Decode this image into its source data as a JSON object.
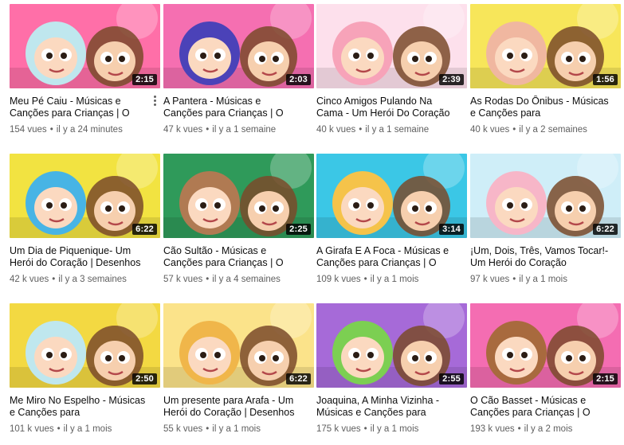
{
  "videos": [
    {
      "title": "Meu Pé Caiu - Músicas e Canções para Crianças | O",
      "views": "154 vues",
      "age": "il y a 24 minutes",
      "duration": "2:15",
      "bg": "#ff6fa8",
      "accent": "#bfe7ee",
      "icon": "kids-dentist-thumbnail-icon",
      "menu": true
    },
    {
      "title": "A Pantera - Músicas e Canções para Crianças | O",
      "views": "47 k vues",
      "age": "il y a 1 semaine",
      "duration": "2:03",
      "bg": "#f56fb1",
      "accent": "#4b42b8",
      "icon": "blue-panther-thumbnail-icon"
    },
    {
      "title": "Cinco Amigos Pulando Na Cama - Um Herói Do Coração",
      "views": "40 k vues",
      "age": "il y a 1 semaine",
      "duration": "2:39",
      "bg": "#fde0ec",
      "accent": "#f7a3b9",
      "icon": "piglet-friends-thumbnail-icon"
    },
    {
      "title": "As Rodas Do Ônibus - Músicas e Canções para",
      "views": "40 k vues",
      "age": "il y a 2 semaines",
      "duration": "1:56",
      "bg": "#f7e65a",
      "accent": "#f0b7a0",
      "icon": "cat-bus-driver-thumbnail-icon"
    },
    {
      "title": "Um Dia de Piquenique- Um Herói do Coração | Desenhos",
      "views": "42 k vues",
      "age": "il y a 3 semaines",
      "duration": "6:22",
      "bg": "#f2e341",
      "accent": "#47b4e5",
      "icon": "clown-picnic-thumbnail-icon"
    },
    {
      "title": "Cão Sultão - Músicas e Canções para Crianças | O",
      "views": "57 k vues",
      "age": "il y a 4 semaines",
      "duration": "2:25",
      "bg": "#2f9a5a",
      "accent": "#b07a52",
      "icon": "dog-basketball-thumbnail-icon"
    },
    {
      "title": "A Girafa E A Foca - Músicas e Canções para Crianças | O",
      "views": "109 k vues",
      "age": "il y a 1 mois",
      "duration": "3:14",
      "bg": "#3bc7e6",
      "accent": "#f5c34a",
      "icon": "giraffe-seal-thumbnail-icon"
    },
    {
      "title": "¡Um, Dois, Três, Vamos Tocar!- Um Herói do Coração",
      "views": "97 k vues",
      "age": "il y a 1 mois",
      "duration": "6:22",
      "bg": "#cfeef8",
      "accent": "#f7b6c8",
      "icon": "pig-cat-music-thumbnail-icon"
    },
    {
      "title": "Me Miro No Espelho - Músicas e Canções para",
      "views": "101 k vues",
      "age": "il y a 1 mois",
      "duration": "2:50",
      "bg": "#f3d942",
      "accent": "#bfe7ee",
      "icon": "kids-mirror-thumbnail-icon"
    },
    {
      "title": "Um presente para Arafa - Um Herói do Coração | Desenhos",
      "views": "55 k vues",
      "age": "il y a 1 mois",
      "duration": "6:22",
      "bg": "#fbe38a",
      "accent": "#f0b64a",
      "icon": "clown-giraffe-gift-thumbnail-icon"
    },
    {
      "title": "Joaquina, A Minha Vizinha - Músicas e Canções para",
      "views": "175 k vues",
      "age": "il y a 1 mois",
      "duration": "2:55",
      "bg": "#a66ad8",
      "accent": "#7ccf52",
      "icon": "bugs-friends-thumbnail-icon"
    },
    {
      "title": "O Cão Basset - Músicas e Canções para Crianças | O",
      "views": "193 k vues",
      "age": "il y a 2 mois",
      "duration": "2:15",
      "bg": "#f46db2",
      "accent": "#a86a3e",
      "icon": "basset-dog-thumbnail-icon"
    }
  ],
  "separator": "•"
}
